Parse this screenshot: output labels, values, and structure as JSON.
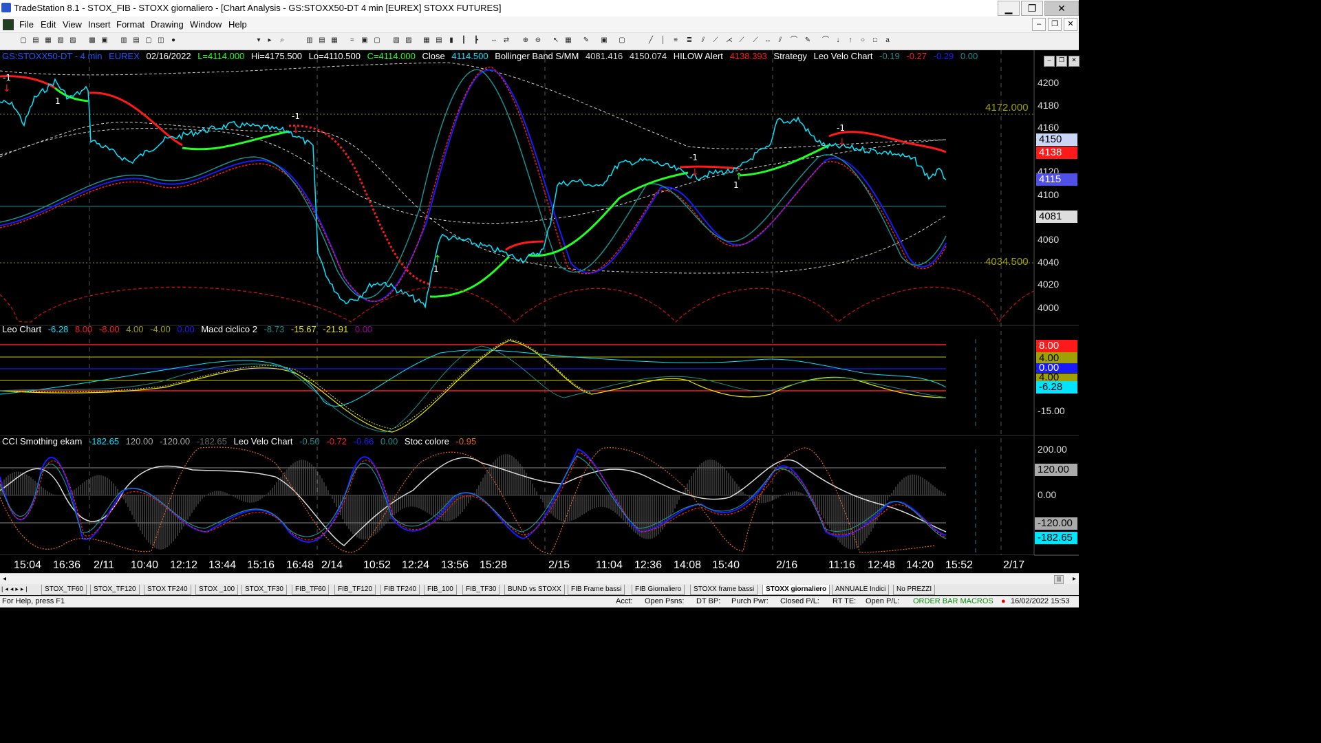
{
  "window": {
    "title": "TradeStation 8.1 - STOX_FIB - STOXX giornaliero - [Chart Analysis - GS:STOXX50-DT  4 min  [EUREX] STOXX FUTURES]",
    "minimize": "▁",
    "maximize": "❐",
    "close": "✕"
  },
  "menu": [
    "File",
    "Edit",
    "View",
    "Insert",
    "Format",
    "Drawing",
    "Window",
    "Help"
  ],
  "toolbar": {
    "symbol_value": "x"
  },
  "header": {
    "symbol": "GS:STOXX50-DT - 4 min",
    "exchange": "EUREX",
    "date": "02/16/2022",
    "low": "L=4114.000",
    "high": "Hi=4175.500",
    "lo": "Lo=4110.500",
    "close_c": "C=4114.000",
    "close_label": "Close",
    "close_value": "4114.500",
    "boll_label": "Bollinger Band S/MM",
    "boll_v1": "4081.416",
    "boll_v2": "4150.074",
    "hilow_label": "HILOW Alert",
    "hilow_v": "4138.393",
    "strategy": "Strategy",
    "leo_label": "Leo Velo Chart",
    "leo_v1": "-0.19",
    "leo_v2": "-0.27",
    "leo_v3": "-0.29",
    "leo_v4": "0.00"
  },
  "panel2_header": {
    "leo_chart": "Leo Chart",
    "v1": "-6.28",
    "v2": "8.00",
    "v3": "-8.00",
    "v4": "4.00",
    "v5": "-4.00",
    "v6": "0.00",
    "macd_label": "Macd ciclico 2",
    "m1": "-8.73",
    "m2": "-15.67",
    "m3": "-21.91",
    "m4": "0.00"
  },
  "panel3_header": {
    "cci_label": "CCI Smothing ekam",
    "c1": "-182.65",
    "c2": "120.00",
    "c3": "-120.00",
    "c4": "-182.65",
    "leo_label": "Leo Velo Chart",
    "l1": "-0.50",
    "l2": "-0.72",
    "l3": "-0.66",
    "l4": "0.00",
    "stoc_label": "Stoc colore",
    "s1": "-0.95"
  },
  "price_axis": {
    "ticks": [
      "4200",
      "4180",
      "4160",
      "4120",
      "4100",
      "4060",
      "4040",
      "4020",
      "4000"
    ],
    "tag_4150": "4150",
    "tag_4138": "4138",
    "tag_4115": "4115",
    "tag_4081": "4081",
    "level_high": "4172.000",
    "level_low": "4034.500"
  },
  "panel2_axis": {
    "tag_8": "8.00",
    "tag_4": "4.00",
    "tag_0": "0.00",
    "tag_m4": "4.00",
    "tag_m628": "-6.28",
    "tick_m15": "-15.00"
  },
  "panel3_axis": {
    "tick_200": "200.00",
    "tag_120": "120.00",
    "tick_0": "0.00",
    "tag_m120": "-120.00",
    "tag_m182": "-182.65"
  },
  "time_axis": [
    "15:04",
    "16:36",
    "2/11",
    "10:40",
    "12:12",
    "13:44",
    "15:16",
    "16:48",
    "2/14",
    "10:52",
    "12:24",
    "13:56",
    "15:28",
    "2/15",
    "11:04",
    "12:36",
    "14:08",
    "15:40",
    "2/16",
    "11:16",
    "12:48",
    "14:20",
    "15:52",
    "2/17"
  ],
  "markers": [
    "-1",
    "1",
    "-1",
    "1",
    "-1",
    "1",
    "-1"
  ],
  "tabs": [
    "STOX_TF60",
    "STOX_TF120",
    "STOX TF240",
    "STOX _100",
    "STOX_TF30",
    "FIB_TF60",
    "FIB_TF120",
    "FIB TF240",
    "FIB_100",
    "FIB_TF30",
    "BUND vs STOXX",
    "FIB Frame bassi",
    "FIB Giornaliero",
    "STOXX frame bassi",
    "STOXX giornaliero",
    "ANNUALE Indici",
    "No PREZZI"
  ],
  "active_tab": "STOXX giornaliero",
  "status": {
    "help": "For Help, press F1",
    "acct": "Acct:",
    "open_psns": "Open Psns:",
    "dt_bp": "DT BP:",
    "purch_pwr": "Purch Pwr:",
    "closed_pl": "Closed P/L:",
    "rt_te": "RT TE:",
    "open_pl": "Open P/L:",
    "order_bar": "ORDER BAR  MACROS",
    "datetime": "16/02/2022 15:53"
  },
  "colors": {
    "price": "#00e5ff",
    "red": "#ff1a1a",
    "green": "#22ff22",
    "blue": "#1a1aff",
    "teal": "#1a8f8f",
    "yellow": "#e6e600",
    "dim": "#9a9a9a"
  }
}
